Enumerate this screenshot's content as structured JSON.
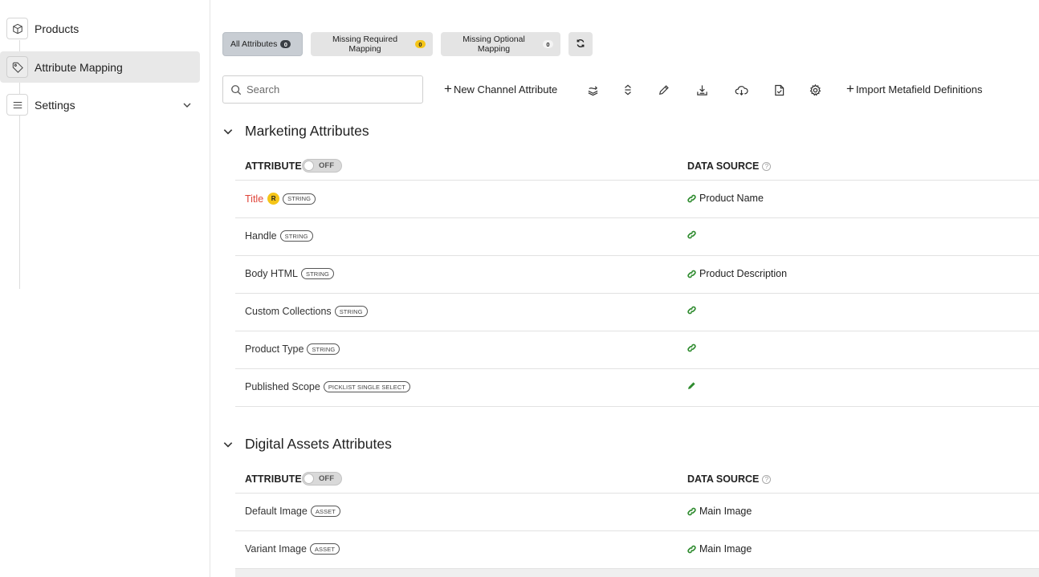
{
  "sidebar": {
    "items": [
      {
        "label": "Products",
        "icon": "cube-icon",
        "active": false
      },
      {
        "label": "Attribute Mapping",
        "icon": "tag-icon",
        "active": true
      },
      {
        "label": "Settings",
        "icon": "list-icon",
        "active": false,
        "expandable": true
      }
    ]
  },
  "filters": {
    "all": {
      "label": "All Attributes",
      "count": "0"
    },
    "required": {
      "label": "Missing Required Mapping",
      "count": "0"
    },
    "optional": {
      "label": "Missing Optional Mapping",
      "count": "0"
    },
    "refresh_icon": "refresh-icon"
  },
  "toolbar": {
    "search_placeholder": "Search",
    "new_attribute_label": "New Channel Attribute",
    "icons": [
      "layers-icon",
      "expand-collapse-icon",
      "pencil-icon",
      "download-icon",
      "cloud-download-icon",
      "file-check-icon",
      "gear-icon"
    ],
    "import_label": "Import Metafield Definitions"
  },
  "sections": [
    {
      "title": "Marketing Attributes",
      "attribute_header": "ATTRIBUTE",
      "toggle_label": "OFF",
      "data_source_header": "DATA SOURCE",
      "rows": [
        {
          "name": "Title",
          "required": true,
          "required_badge": "R",
          "type": "STRING",
          "source": "Product Name",
          "source_icon": "link-icon"
        },
        {
          "name": "Handle",
          "required": false,
          "type": "STRING",
          "source": "",
          "source_icon": "link-icon"
        },
        {
          "name": "Body HTML",
          "required": false,
          "type": "STRING",
          "source": "Product Description",
          "source_icon": "link-icon"
        },
        {
          "name": "Custom Collections",
          "required": false,
          "type": "STRING",
          "source": "",
          "source_icon": "link-icon"
        },
        {
          "name": "Product Type",
          "required": false,
          "type": "STRING",
          "source": "",
          "source_icon": "link-icon"
        },
        {
          "name": "Published Scope",
          "required": false,
          "type": "PICKLIST SINGLE SELECT",
          "source": "",
          "source_icon": "pencil-icon"
        }
      ]
    },
    {
      "title": "Digital Assets Attributes",
      "attribute_header": "ATTRIBUTE",
      "toggle_label": "OFF",
      "data_source_header": "DATA SOURCE",
      "rows": [
        {
          "name": "Default Image",
          "required": false,
          "type": "ASSET",
          "source": "Main Image",
          "source_icon": "link-icon"
        },
        {
          "name": "Variant Image",
          "required": false,
          "type": "ASSET",
          "source": "Main Image",
          "source_icon": "link-icon"
        }
      ]
    }
  ],
  "colors": {
    "accent_green": "#2e8b2e",
    "required_red": "#e0453a",
    "badge_yellow": "#f5c518",
    "active_bg": "#e8e8e8"
  }
}
